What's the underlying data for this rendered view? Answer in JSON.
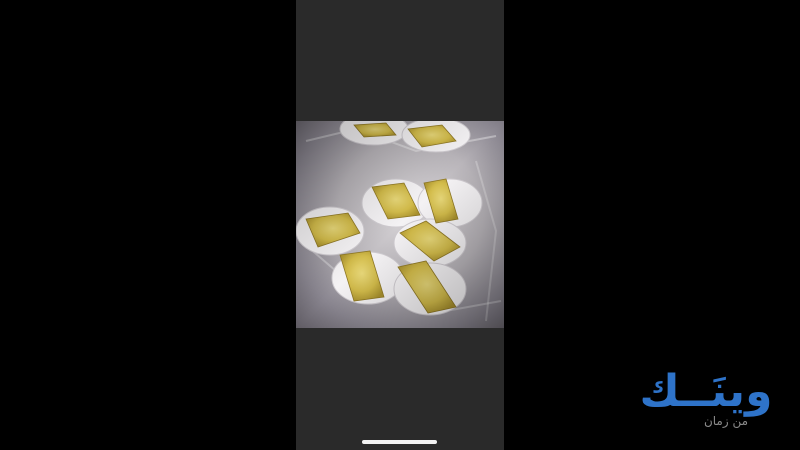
{
  "screen": {
    "background": "#000000",
    "phone_background": "#2a2a2a"
  },
  "photo": {
    "subject": "pastries-in-paper-cups"
  },
  "home_indicator": {
    "color": "#f2f2f2"
  },
  "watermark": {
    "brand": "وينَــك",
    "tagline": "من زمان",
    "brand_color": "#2e73c9",
    "tagline_color": "#8a8a8a"
  }
}
